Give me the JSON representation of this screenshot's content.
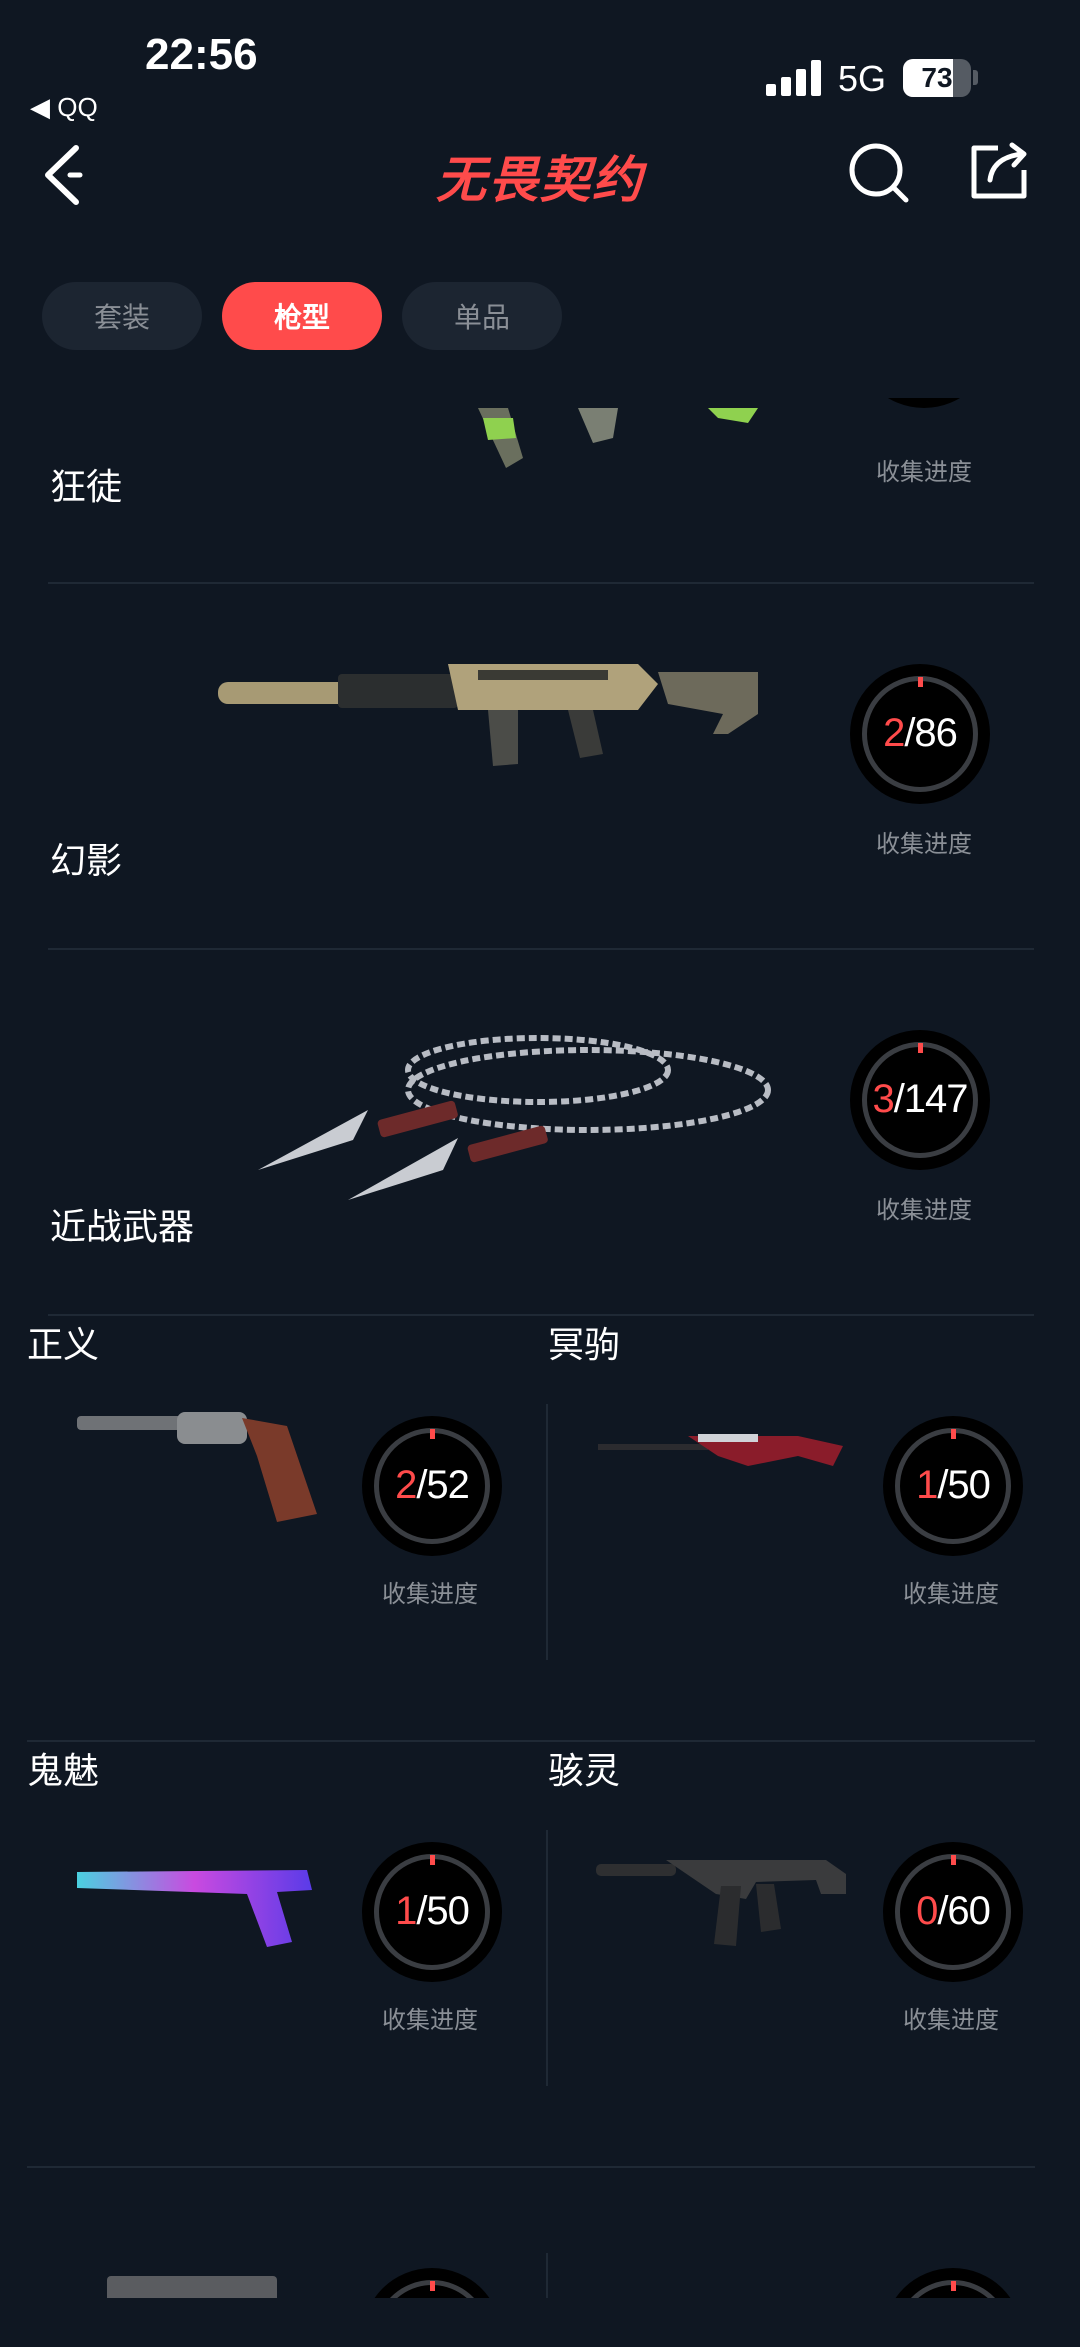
{
  "status_bar": {
    "time": "22:56",
    "back_app": "◀ QQ",
    "network": "5G",
    "battery": "73",
    "battery_level": 0.73
  },
  "nav": {
    "title": "无畏契约",
    "back_icon": "chevron-left-icon",
    "search_icon": "search-icon",
    "share_icon": "share-icon"
  },
  "tabs": [
    {
      "label": "套装",
      "active": false
    },
    {
      "label": "枪型",
      "active": true
    },
    {
      "label": "单品",
      "active": false
    }
  ],
  "progress_label": "收集进度",
  "weapons": [
    {
      "name": "狂徒"
    },
    {
      "name": "幻影",
      "owned": "2",
      "total": "/86"
    },
    {
      "name": "近战武器",
      "owned": "3",
      "total": "/147"
    },
    {
      "name": "正义",
      "owned": "2",
      "total": "/52"
    },
    {
      "name": "冥驹",
      "owned": "1",
      "total": "/50"
    },
    {
      "name": "鬼魅",
      "owned": "1",
      "total": "/50"
    },
    {
      "name": "骇灵",
      "owned": "0",
      "total": "/60"
    }
  ],
  "colors": {
    "accent": "#ff4b4b",
    "background": "#0f1722",
    "tab_bg": "#1c2531",
    "muted_text": "#8a8f96"
  }
}
